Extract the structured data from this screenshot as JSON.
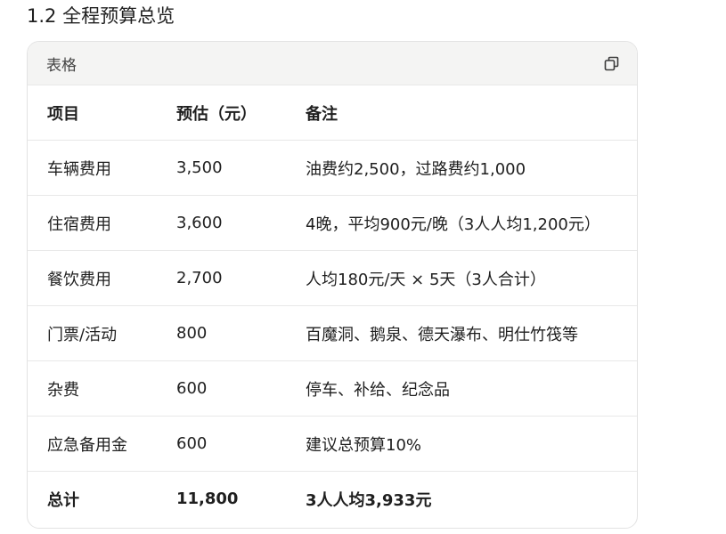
{
  "section": {
    "title": "1.2 全程预算总览"
  },
  "table_card": {
    "label": "表格",
    "copy_icon": "copy-icon",
    "columns": [
      "项目",
      "预估（元）",
      "备注"
    ],
    "rows": [
      [
        "车辆费用",
        "3,500",
        "油费约2,500，过路费约1,000"
      ],
      [
        "住宿费用",
        "3,600",
        "4晚，平均900元/晚（3人人均1,200元）"
      ],
      [
        "餐饮费用",
        "2,700",
        "人均180元/天 × 5天（3人合计）"
      ],
      [
        "门票/活动",
        "800",
        "百魔洞、鹅泉、德天瀑布、明仕竹筏等"
      ],
      [
        "杂费",
        "600",
        "停车、补给、纪念品"
      ],
      [
        "应急备用金",
        "600",
        "建议总预算10%"
      ]
    ],
    "total": [
      "总计",
      "11,800",
      "3人人均3,933元"
    ]
  }
}
